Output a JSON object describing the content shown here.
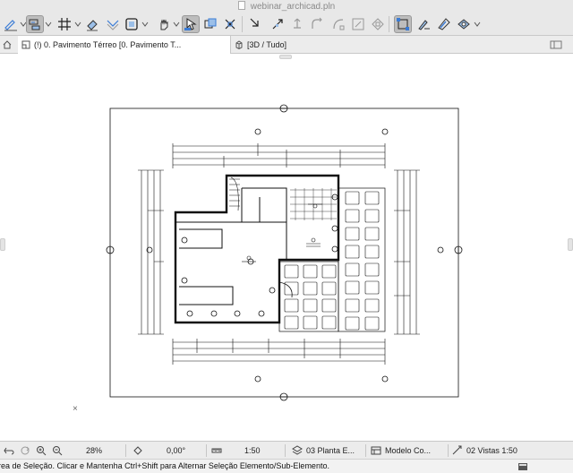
{
  "window": {
    "title": "webinar_archicad.pln"
  },
  "toolbar": {
    "buttons": [
      {
        "name": "pencil-icon"
      },
      {
        "name": "magic-wand-icon"
      },
      {
        "name": "grid-icon"
      },
      {
        "name": "eraser-icon"
      },
      {
        "name": "layer-icon"
      },
      {
        "name": "selection-icon"
      },
      {
        "name": "hand-icon"
      },
      {
        "name": "move-icon"
      },
      {
        "name": "offset-icon"
      },
      {
        "name": "trim-icon"
      },
      {
        "name": "fillet-icon"
      },
      {
        "name": "explode-icon"
      },
      {
        "name": "group-icon"
      },
      {
        "name": "edit-selection-icon"
      },
      {
        "name": "eyedropper-icon"
      },
      {
        "name": "brush-icon"
      }
    ]
  },
  "tabs": [
    {
      "label": "(!) 0. Pavimento Térreo [0. Pavimento T...",
      "active": true
    },
    {
      "label": "[3D / Tudo]",
      "active": false
    }
  ],
  "bottom_bar": {
    "zoom": "28%",
    "angle": "0,00°",
    "scale": "1:50",
    "layer_combo": "03 Planta E...",
    "model_view": "Modelo Co...",
    "dimension": "02 Vistas 1:50"
  },
  "status": {
    "text": "rea de Seleção. Clicar e Mantenha Ctrl+Shift para Alternar Seleção Elemento/Sub-Elemento."
  },
  "colors": {
    "toolbar_bg": "#e8e8e8",
    "active_button": "#bdbdbd",
    "drawing_line": "#111111"
  }
}
